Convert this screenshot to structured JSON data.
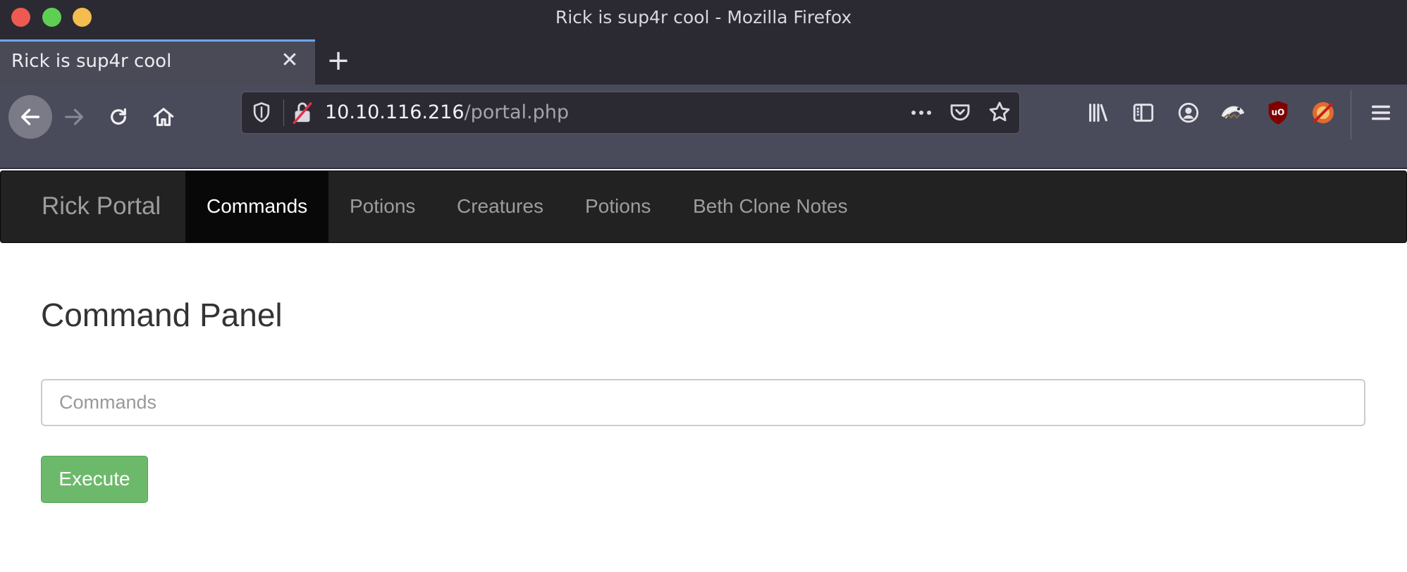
{
  "window": {
    "title": "Rick is sup4r cool - Mozilla Firefox"
  },
  "tabs": [
    {
      "title": "Rick is sup4r cool",
      "close": "✕"
    }
  ],
  "new_tab": "+",
  "url": {
    "host": "10.10.116.216",
    "path": "/portal.php"
  },
  "navbar": {
    "brand": "Rick Portal",
    "items": [
      {
        "label": "Commands",
        "active": true
      },
      {
        "label": "Potions",
        "active": false
      },
      {
        "label": "Creatures",
        "active": false
      },
      {
        "label": "Potions",
        "active": false
      },
      {
        "label": "Beth Clone Notes",
        "active": false
      }
    ]
  },
  "main": {
    "heading": "Command Panel",
    "command_input": {
      "placeholder": "Commands",
      "value": ""
    },
    "execute_label": "Execute"
  },
  "colors": {
    "titlebar": "#2b2a33",
    "toolbar": "#4a4b5a",
    "navbar": "#222222",
    "navbar_active": "#080808",
    "execute_button": "#6db96b",
    "tab_accent": "#6aa6f5"
  },
  "icons": [
    "back-arrow-icon",
    "forward-arrow-icon",
    "reload-icon",
    "home-icon",
    "shield-icon",
    "insecure-lock-icon",
    "more-actions-icon",
    "pocket-icon",
    "bookmark-star-icon",
    "library-icon",
    "sidebar-icon",
    "account-icon",
    "extension-icon",
    "ublock-icon",
    "noscript-icon",
    "hamburger-menu-icon"
  ]
}
